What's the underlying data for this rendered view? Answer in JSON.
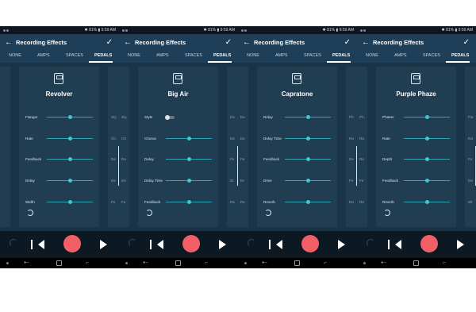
{
  "status": {
    "text": "✱ 81% ▮ 9:59 AM"
  },
  "app": {
    "title": "Recording Effects",
    "back_icon": "arrow-left-icon",
    "confirm_icon": "check-icon"
  },
  "tabs": [
    "NONE",
    "AMPS",
    "SPACES",
    "PEDALS"
  ],
  "active_tab": "PEDALS",
  "colors": {
    "background": "#1b3346",
    "card": "#213d52",
    "slider": "#2ea4b5",
    "thumb": "#41c6d6",
    "record": "#f35f67"
  },
  "screens": [
    {
      "pedal": "Revolver",
      "params": [
        {
          "label": "Flanger",
          "type": "slider",
          "value": 0.5
        },
        {
          "label": "Rate",
          "type": "slider",
          "value": 0.5
        },
        {
          "label": "Feedback",
          "type": "slider",
          "value": 0.5
        },
        {
          "label": "Delay",
          "type": "slider",
          "value": 0.5
        },
        {
          "label": "Width",
          "type": "slider",
          "value": 0.5
        }
      ],
      "peek_right": [
        "Sty",
        "Ch",
        "De",
        "De",
        "Fe"
      ]
    },
    {
      "pedal": "Big Air",
      "params": [
        {
          "label": "Style",
          "type": "toggle",
          "value": 0
        },
        {
          "label": "Chorus",
          "type": "slider",
          "value": 0.5
        },
        {
          "label": "Delay",
          "type": "slider",
          "value": 0.5
        },
        {
          "label": "Delay Time",
          "type": "slider",
          "value": 0.5
        },
        {
          "label": "Feedback",
          "type": "slider",
          "value": 0.5
        }
      ],
      "peek_right": [
        "De",
        "De",
        "Fe",
        "Dr",
        "Re"
      ]
    },
    {
      "pedal": "Capratone",
      "params": [
        {
          "label": "Delay",
          "type": "slider",
          "value": 0.5
        },
        {
          "label": "Delay Time",
          "type": "slider",
          "value": 0.5
        },
        {
          "label": "Feedback",
          "type": "slider",
          "value": 0.5
        },
        {
          "label": "Drive",
          "type": "slider",
          "value": 0.5
        },
        {
          "label": "Reverb",
          "type": "slider",
          "value": 0.5
        }
      ],
      "peek_right": [
        "Ph",
        "Ra",
        "De",
        "Fe",
        "Re"
      ]
    },
    {
      "pedal": "Purple Phaze",
      "params": [
        {
          "label": "Phaser",
          "type": "slider",
          "value": 0.5
        },
        {
          "label": "Rate",
          "type": "slider",
          "value": 0.5
        },
        {
          "label": "Depth",
          "type": "slider",
          "value": 0.5
        },
        {
          "label": "Feedback",
          "type": "slider",
          "value": 0.5
        },
        {
          "label": "Reverb",
          "type": "slider",
          "value": 0.5
        }
      ],
      "peek_right": [
        "Fla",
        "Ra",
        "Fe",
        "De",
        "Wi"
      ]
    }
  ],
  "transport": {
    "undo_icon": "undo-icon",
    "prev_icon": "skip-back-icon",
    "record_icon": "record-button",
    "play_icon": "play-icon"
  },
  "navbar": {
    "back_icon": "android-back-icon",
    "home_icon": "android-home-icon",
    "recent_icon": "android-recents-icon"
  }
}
